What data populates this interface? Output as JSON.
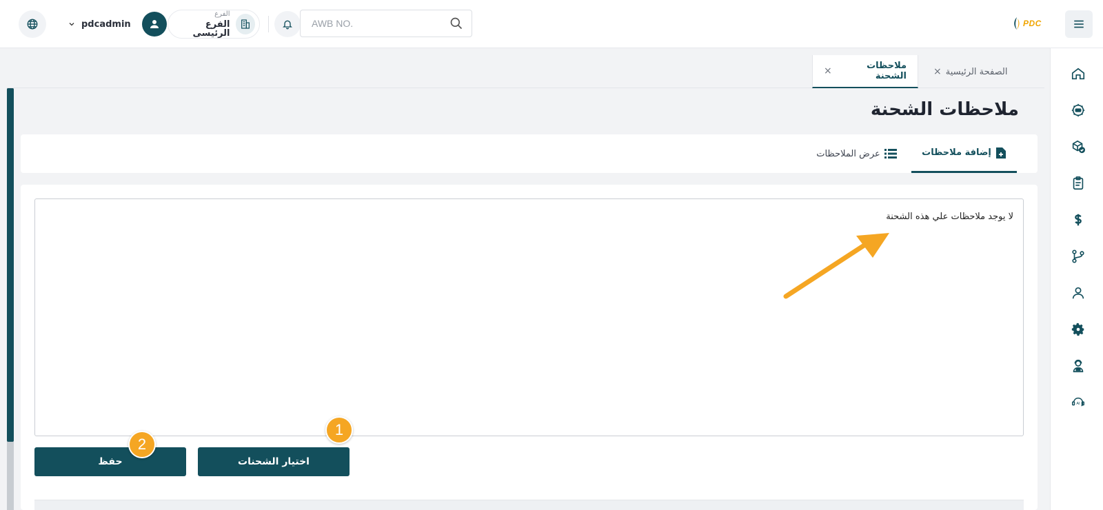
{
  "header": {
    "username": "pdcadmin",
    "branch": {
      "sub_label": "الفرع",
      "name": "الفرع الرئيسى"
    },
    "search": {
      "placeholder": "AWB NO."
    },
    "logo_text": "PDC"
  },
  "tabs": [
    {
      "label": "الصفحة الرئيسية",
      "active": false
    },
    {
      "label": "ملاحظات الشحنة",
      "active": true
    }
  ],
  "page": {
    "title": "ملاحظات الشحنة",
    "subtabs": [
      {
        "label": "إضافة ملاحظات",
        "icon": "file-plus-icon",
        "active": true
      },
      {
        "label": "عرض الملاحظات",
        "icon": "list-icon",
        "active": false
      }
    ],
    "notes_text": "لا يوجد ملاحظات علي هذه الشحنة"
  },
  "buttons": {
    "select_shipments": "اختيار الشحنات",
    "save": "حفظ"
  },
  "badges": {
    "one": "1",
    "two": "2"
  },
  "sidenav": [
    "home-icon",
    "new-icon",
    "package-check-icon",
    "clipboard-icon",
    "dollar-icon",
    "git-branch-icon",
    "user-icon",
    "settings-icon",
    "support-agent-icon",
    "ai-assistant-icon"
  ],
  "colors": {
    "primary": "#134f5c",
    "accent": "#f5a623",
    "background": "#f2f3f5"
  }
}
